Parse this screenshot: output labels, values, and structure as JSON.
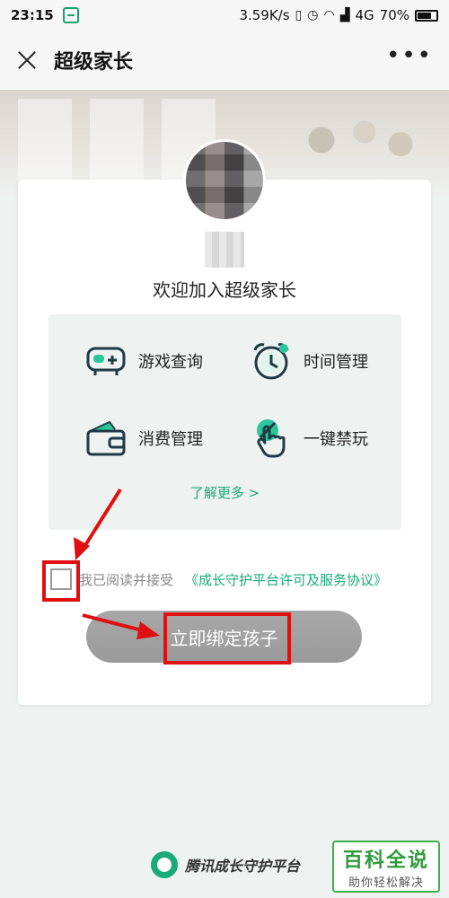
{
  "status_bar": {
    "time": "23:15",
    "speed": "3.59K/s",
    "network": "4G",
    "battery": "70%"
  },
  "header": {
    "title": "超级家长",
    "more": "•••"
  },
  "profile": {
    "welcome": "欢迎加入超级家长"
  },
  "features": {
    "items": [
      {
        "label": "游戏查询",
        "icon": "gamepad-icon"
      },
      {
        "label": "时间管理",
        "icon": "alarm-clock-icon"
      },
      {
        "label": "消费管理",
        "icon": "wallet-icon"
      },
      {
        "label": "一键禁玩",
        "icon": "tap-ban-icon"
      }
    ],
    "learn_more": "了解更多 >"
  },
  "agreement": {
    "text": "我已阅读并接受",
    "link": "《成长守护平台许可及服务协议》",
    "checked": false
  },
  "bind_button": {
    "label": "立即绑定孩子"
  },
  "footer": {
    "logo_text": "腾讯成长守护平台"
  },
  "watermark": {
    "main": "百科全说",
    "sub": "助你轻松解决"
  },
  "colors": {
    "accent": "#1aaa78",
    "highlight": "#e01010",
    "button": "#9e9e9e"
  }
}
